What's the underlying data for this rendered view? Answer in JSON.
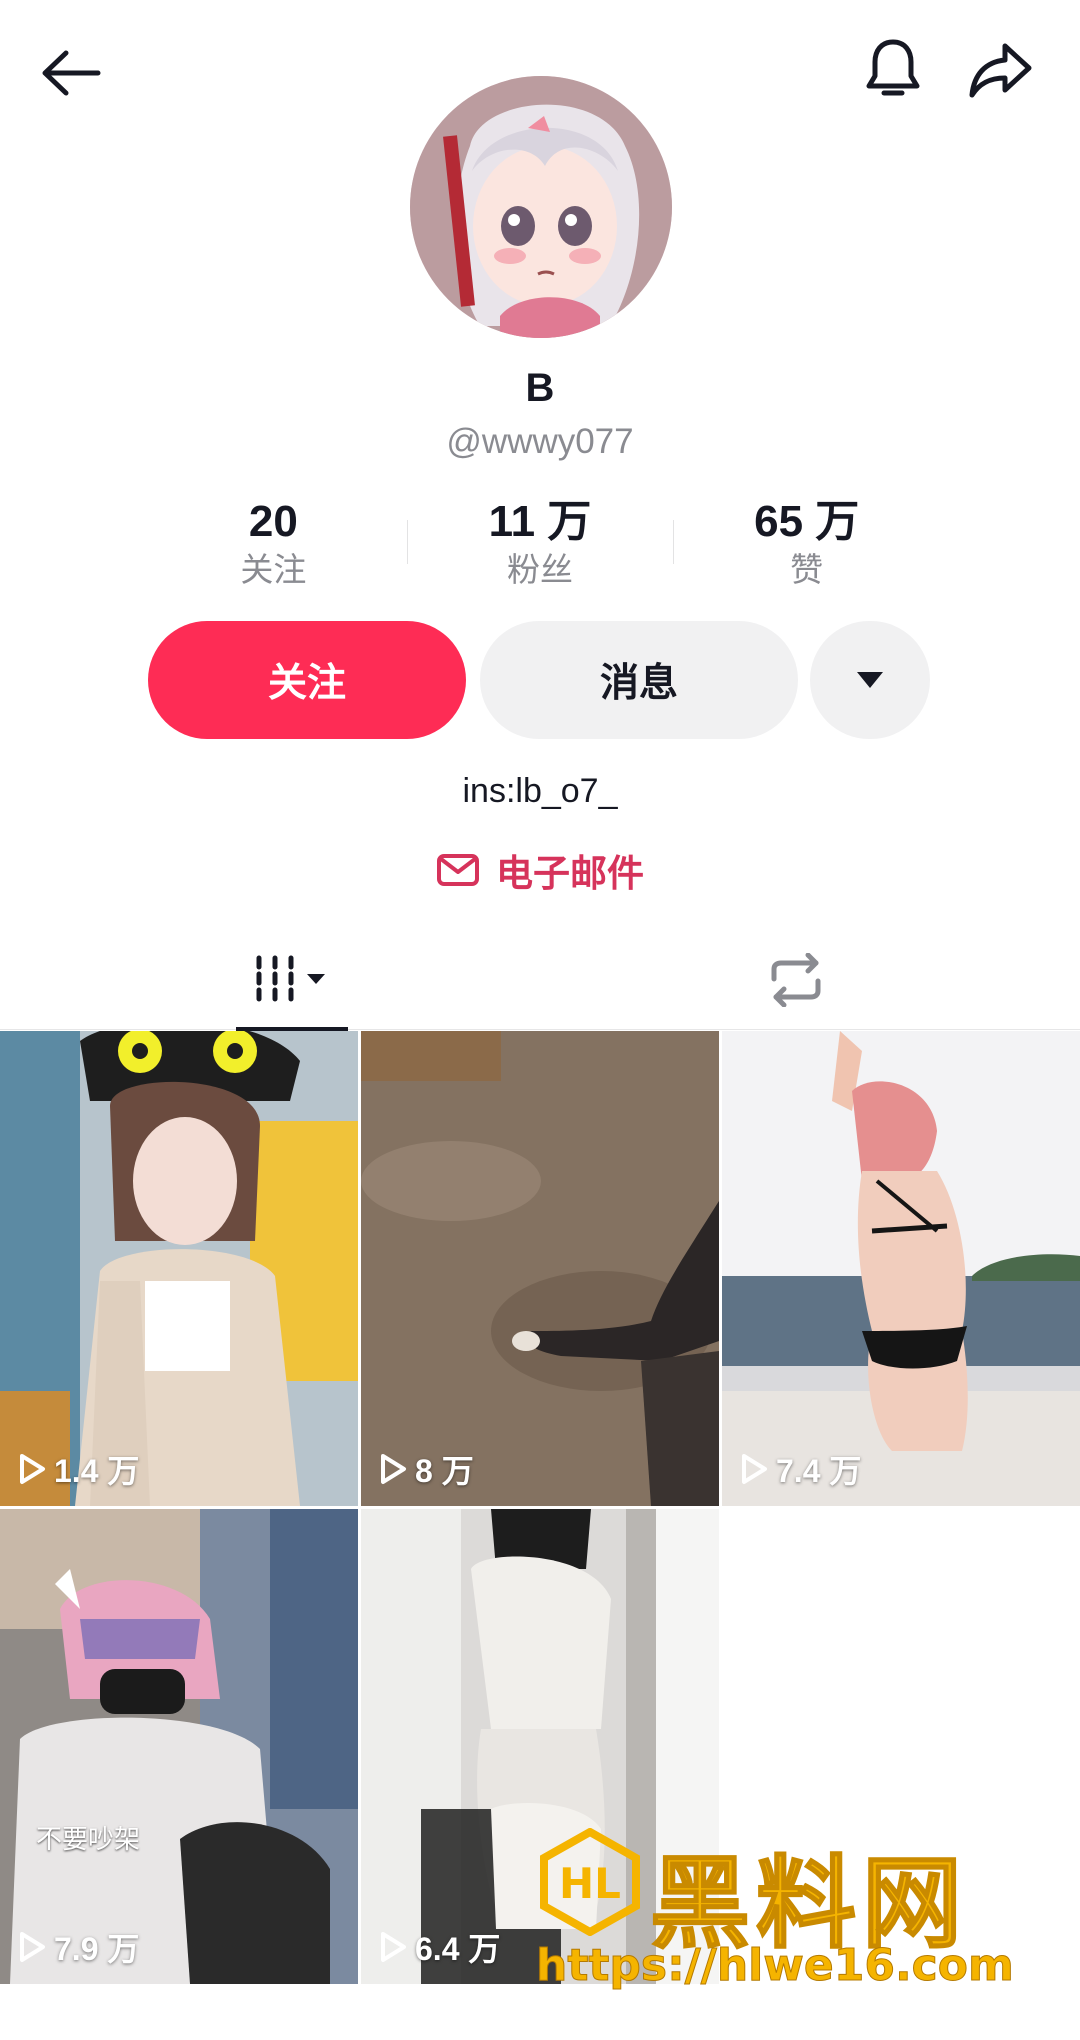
{
  "profile": {
    "name": "B",
    "handle": "@wwwy077",
    "bio": "ins:lb_o7_",
    "email_label": "电子邮件"
  },
  "stats": [
    {
      "value": "20",
      "label": "关注"
    },
    {
      "value": "11 万",
      "label": "粉丝"
    },
    {
      "value": "65 万",
      "label": "赞"
    }
  ],
  "actions": {
    "follow_label": "关注",
    "message_label": "消息"
  },
  "icons": {
    "back": "back-arrow-icon",
    "bell": "bell-icon",
    "share": "share-icon",
    "dropdown": "caret-down-icon",
    "email": "mail-icon",
    "videos_tab": "grid-columns-icon",
    "reposts_tab": "repost-icon",
    "play": "play-icon"
  },
  "videos": [
    {
      "views": "1.4 万"
    },
    {
      "views": "8 万"
    },
    {
      "views": "7.4 万"
    },
    {
      "views": "7.9 万",
      "overlay_text": "不要吵架"
    },
    {
      "views": "6.4 万"
    }
  ],
  "watermark": {
    "title": "黑料网",
    "url": "https://hlwe16.com",
    "logo_text": "HL"
  },
  "colors": {
    "accent": "#fe2c55",
    "email": "#d6335b",
    "watermark": "#f5b400"
  }
}
